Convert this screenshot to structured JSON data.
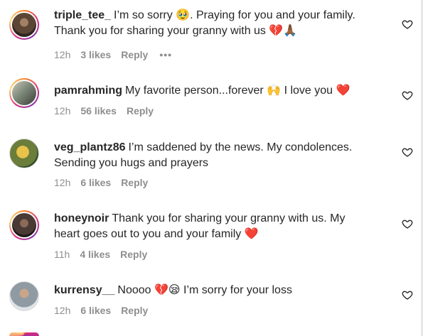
{
  "comments": [
    {
      "username": "triple_tee_",
      "line1": "I’m so sorry 🥹. Praying for you and your family.",
      "line2": "Thank you for sharing your granny with us 💔🙏🏾",
      "time": "12h",
      "likes": "3 likes",
      "reply": "Reply",
      "more": "•••",
      "avatar_color": "#5b4636"
    },
    {
      "username": "pamrahming",
      "line1": "My favorite person...forever 🙌 I love you ❤️",
      "line2": "",
      "time": "12h",
      "likes": "56 likes",
      "reply": "Reply",
      "avatar_color": "#7c8a7a"
    },
    {
      "username": "veg_plantz86",
      "line1": "I’m saddened by the news. My condolences.",
      "line2": "Sending you hugs and prayers",
      "time": "12h",
      "likes": "6 likes",
      "reply": "Reply",
      "avatar_color": "#6b7d3a"
    },
    {
      "username": "honeynoir",
      "line1": "Thank you for sharing your granny with us. My",
      "line2": "heart goes out to you and your family ❤️",
      "time": "11h",
      "likes": "4 likes",
      "reply": "Reply",
      "avatar_color": "#4a3a35"
    },
    {
      "username": "kurrensy__",
      "line1": "Noooo 💔😪 I’m sorry for your loss",
      "line2": "",
      "time": "12h",
      "likes": "6 likes",
      "reply": "Reply",
      "avatar_color": "#8f9aa3"
    }
  ],
  "icons": {
    "like": "heart-outline-icon",
    "more": "more-options-icon"
  },
  "colors": {
    "text": "#262626",
    "muted": "#8e8e8e"
  }
}
